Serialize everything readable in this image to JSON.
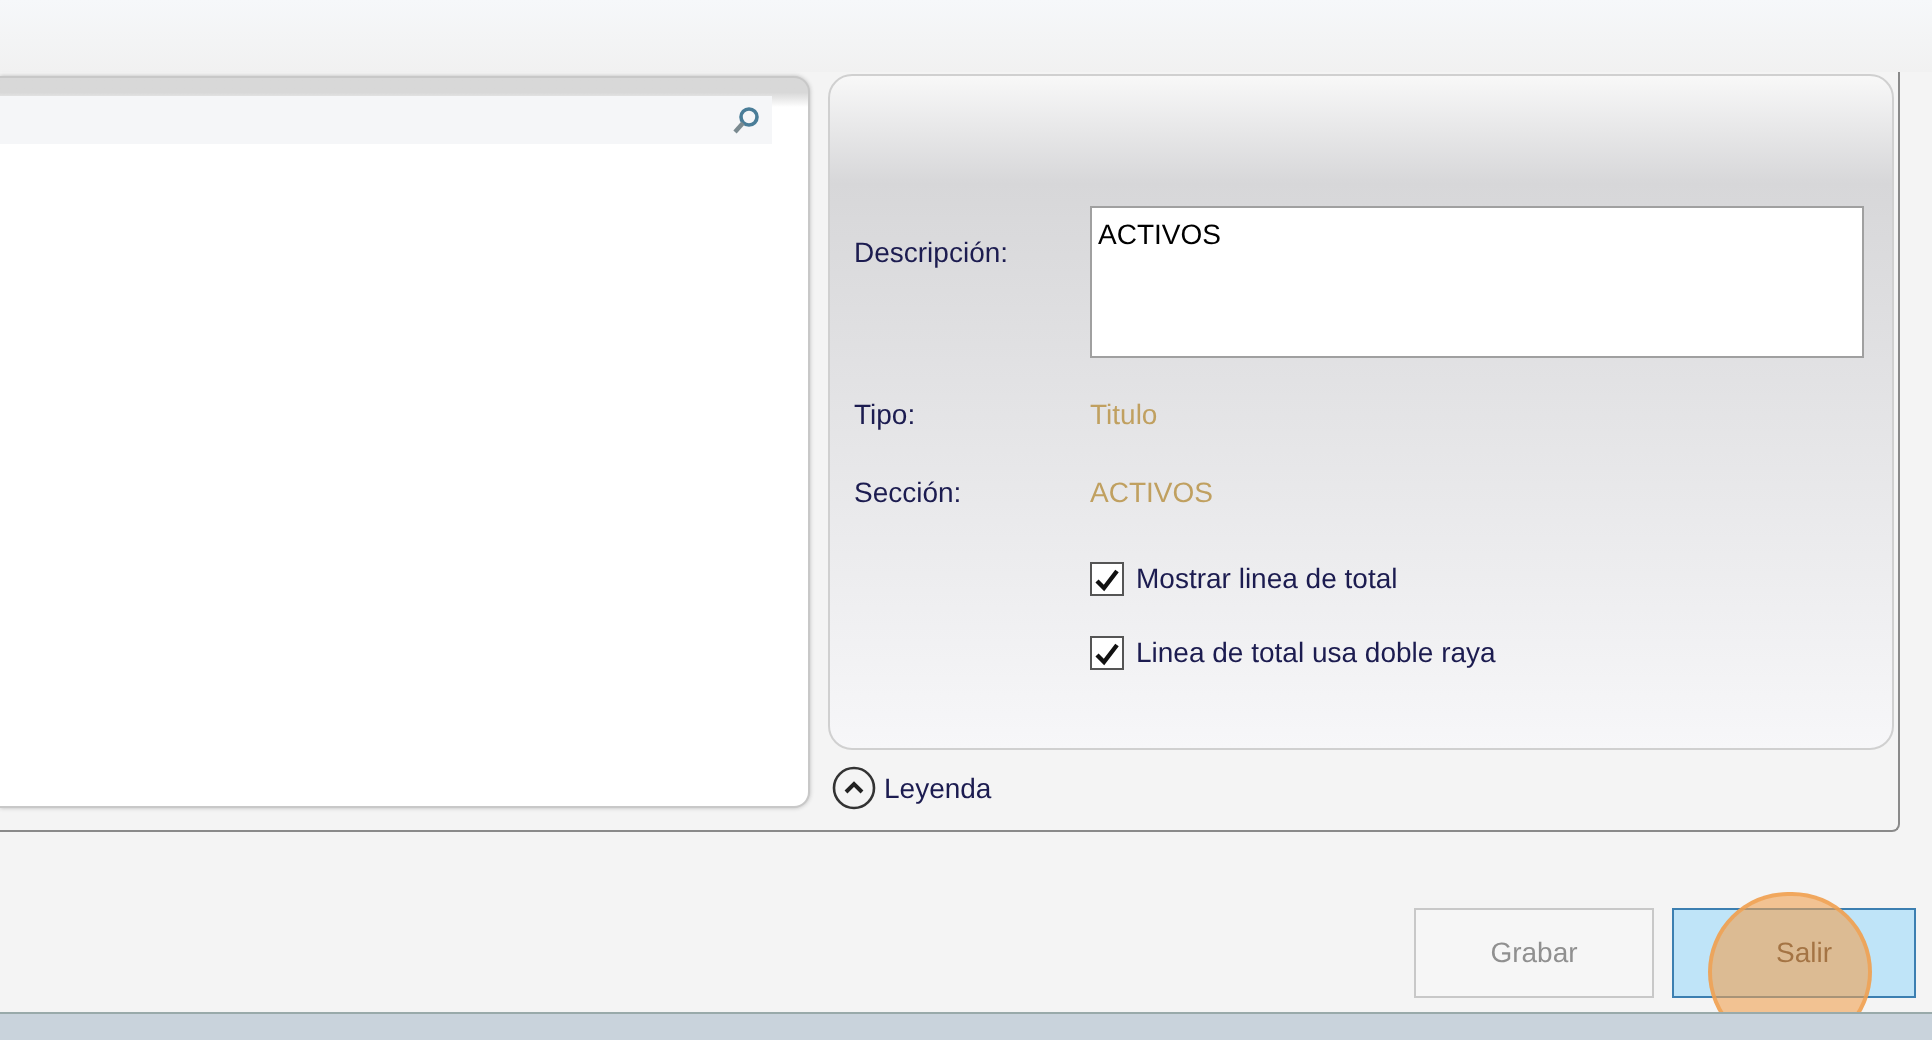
{
  "details": {
    "description_label": "Descripción:",
    "description_value": "ACTIVOS",
    "fields": [
      {
        "label": "Tipo:",
        "value": "Titulo"
      },
      {
        "label": "Sección:",
        "value": "ACTIVOS"
      }
    ],
    "options": [
      {
        "label": "Mostrar linea de total",
        "checked": true
      },
      {
        "label": "Linea de total usa doble raya",
        "checked": true
      }
    ]
  },
  "legend": {
    "label": "Leyenda",
    "expanded": true
  },
  "buttons": [
    {
      "label": "Grabar",
      "disabled": true,
      "clicked": false
    },
    {
      "label": "Salir",
      "disabled": false,
      "clicked": true
    }
  ]
}
